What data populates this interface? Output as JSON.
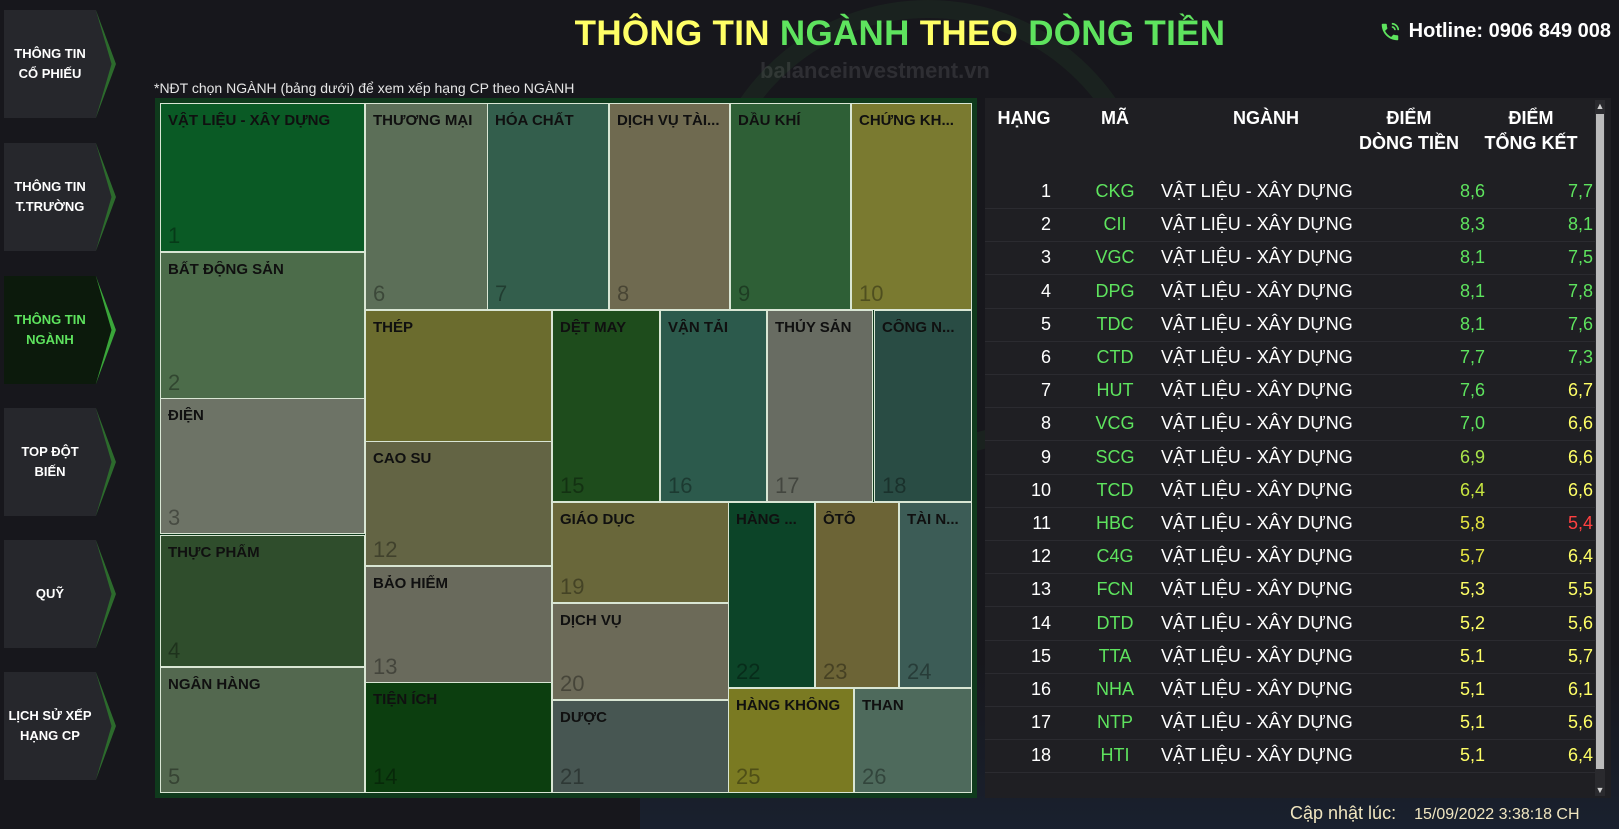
{
  "colors": {
    "yellow": "#ffff66",
    "green": "#5ee35e",
    "red": "#ff4040",
    "panel": "#1f1f23"
  },
  "sidebar": {
    "items": [
      {
        "label": "THÔNG TIN\nCỔ PHIẾU",
        "active": false
      },
      {
        "label": "THÔNG TIN\nT.TRƯỜNG",
        "active": false
      },
      {
        "label": "THÔNG TIN\nNGÀNH",
        "active": true
      },
      {
        "label": "TOP ĐỘT\nBIẾN",
        "active": false
      },
      {
        "label": "QUỸ",
        "active": false
      },
      {
        "label": "LỊCH SỬ XẾP\nHẠNG CP",
        "active": false
      }
    ]
  },
  "header": {
    "title_part1": "THÔNG TIN ",
    "title_part2": "NGÀNH",
    "title_part3": " THEO ",
    "title_part4": "DÒNG TIỀN",
    "hotline": "Hotline: 0906 849 008",
    "watermark": "balanceinvestment.vn",
    "hint": "*NĐT chọn NGÀNH (bảng dưới) để xem xếp hạng CP theo NGÀNH"
  },
  "treemap": {
    "tiles": [
      {
        "label": "VẬT LIỆU - XÂY DỰNG",
        "rank": "1",
        "color": "#0a5a25"
      },
      {
        "label": "BẤT ĐỘNG SẢN",
        "rank": "2",
        "color": "#4c6c4a"
      },
      {
        "label": "ĐIỆN",
        "rank": "3",
        "color": "#6d7366"
      },
      {
        "label": "THỰC PHẨM",
        "rank": "4",
        "color": "#2f4d2c"
      },
      {
        "label": "NGÂN HÀNG",
        "rank": "5",
        "color": "#53684f"
      },
      {
        "label": "THƯƠNG MẠI",
        "rank": "6",
        "color": "#5c6f58"
      },
      {
        "label": "HÓA CHẤT",
        "rank": "7",
        "color": "#335e4c"
      },
      {
        "label": "DỊCH VỤ TÀI...",
        "rank": "8",
        "color": "#6f6a50"
      },
      {
        "label": "DẦU KHÍ",
        "rank": "9",
        "color": "#2e5f36"
      },
      {
        "label": "CHỨNG KH...",
        "rank": "10",
        "color": "#7a7a30"
      },
      {
        "label": "THÉP",
        "rank": "11",
        "color": "#6b6c2e"
      },
      {
        "label": "CAO SU",
        "rank": "12",
        "color": "#636444"
      },
      {
        "label": "BẢO HIỂM",
        "rank": "13",
        "color": "#696a5c"
      },
      {
        "label": "TIỆN ÍCH",
        "rank": "14",
        "color": "#0c3e0f"
      },
      {
        "label": "DỆT MAY",
        "rank": "15",
        "color": "#1e4c1c"
      },
      {
        "label": "VẬN TẢI",
        "rank": "16",
        "color": "#2c5a4c"
      },
      {
        "label": "THỦY SẢN",
        "rank": "17",
        "color": "#686c62"
      },
      {
        "label": "CÔNG N...",
        "rank": "18",
        "color": "#294c44"
      },
      {
        "label": "GIÁO DỤC",
        "rank": "19",
        "color": "#69673a"
      },
      {
        "label": "DỊCH VỤ",
        "rank": "20",
        "color": "#6c6a58"
      },
      {
        "label": "DƯỢC",
        "rank": "21",
        "color": "#475652"
      },
      {
        "label": "HÀNG ...",
        "rank": "22",
        "color": "#0c4428"
      },
      {
        "label": "ÔTÔ",
        "rank": "23",
        "color": "#6c6436"
      },
      {
        "label": "TÀI N...",
        "rank": "24",
        "color": "#3c5c56"
      },
      {
        "label": "HÀNG KHÔNG",
        "rank": "25",
        "color": "#7a7a22"
      },
      {
        "label": "THAN",
        "rank": "26",
        "color": "#4e6a5c"
      }
    ]
  },
  "table": {
    "headers": {
      "rank": "HẠNG",
      "code": "MÃ",
      "sector": "NGÀNH",
      "flow_line1": "ĐIỂM",
      "flow_line2": "DÒNG TIỀN",
      "total_line1": "ĐIỂM",
      "total_line2": "TỔNG KẾT"
    },
    "rows": [
      {
        "rank": "1",
        "code": "CKG",
        "sector": "VẬT LIỆU - XÂY DỰNG",
        "flow": "8,6",
        "total": "7,7",
        "flow_color": "#5ee35e",
        "total_color": "#5ee35e"
      },
      {
        "rank": "2",
        "code": "CII",
        "sector": "VẬT LIỆU - XÂY DỰNG",
        "flow": "8,3",
        "total": "8,1",
        "flow_color": "#5ee35e",
        "total_color": "#5ee35e"
      },
      {
        "rank": "3",
        "code": "VGC",
        "sector": "VẬT LIỆU - XÂY DỰNG",
        "flow": "8,1",
        "total": "7,5",
        "flow_color": "#5ee35e",
        "total_color": "#5ee35e"
      },
      {
        "rank": "4",
        "code": "DPG",
        "sector": "VẬT LIỆU - XÂY DỰNG",
        "flow": "8,1",
        "total": "7,8",
        "flow_color": "#5ee35e",
        "total_color": "#5ee35e"
      },
      {
        "rank": "5",
        "code": "TDC",
        "sector": "VẬT LIỆU - XÂY DỰNG",
        "flow": "8,1",
        "total": "7,6",
        "flow_color": "#5ee35e",
        "total_color": "#5ee35e"
      },
      {
        "rank": "6",
        "code": "CTD",
        "sector": "VẬT LIỆU - XÂY DỰNG",
        "flow": "7,7",
        "total": "7,3",
        "flow_color": "#5ee35e",
        "total_color": "#5ee35e"
      },
      {
        "rank": "7",
        "code": "HUT",
        "sector": "VẬT LIỆU - XÂY DỰNG",
        "flow": "7,6",
        "total": "6,7",
        "flow_color": "#5ee35e",
        "total_color": "#ffff66"
      },
      {
        "rank": "8",
        "code": "VCG",
        "sector": "VẬT LIỆU - XÂY DỰNG",
        "flow": "7,0",
        "total": "6,6",
        "flow_color": "#5ee35e",
        "total_color": "#ffff66"
      },
      {
        "rank": "9",
        "code": "SCG",
        "sector": "VẬT LIỆU - XÂY DỰNG",
        "flow": "6,9",
        "total": "6,6",
        "flow_color": "#a8e34a",
        "total_color": "#ffff66"
      },
      {
        "rank": "10",
        "code": "TCD",
        "sector": "VẬT LIỆU - XÂY DỰNG",
        "flow": "6,4",
        "total": "6,6",
        "flow_color": "#c8e640",
        "total_color": "#ffff66"
      },
      {
        "rank": "11",
        "code": "HBC",
        "sector": "VẬT LIỆU - XÂY DỰNG",
        "flow": "5,8",
        "total": "5,4",
        "flow_color": "#e6e640",
        "total_color": "#ff4040"
      },
      {
        "rank": "12",
        "code": "C4G",
        "sector": "VẬT LIỆU - XÂY DỰNG",
        "flow": "5,7",
        "total": "6,4",
        "flow_color": "#e6e640",
        "total_color": "#ffff66"
      },
      {
        "rank": "13",
        "code": "FCN",
        "sector": "VẬT LIỆU - XÂY DỰNG",
        "flow": "5,3",
        "total": "5,5",
        "flow_color": "#ffff66",
        "total_color": "#ffff66"
      },
      {
        "rank": "14",
        "code": "DTD",
        "sector": "VẬT LIỆU - XÂY DỰNG",
        "flow": "5,2",
        "total": "5,6",
        "flow_color": "#ffff66",
        "total_color": "#ffff66"
      },
      {
        "rank": "15",
        "code": "TTA",
        "sector": "VẬT LIỆU - XÂY DỰNG",
        "flow": "5,1",
        "total": "5,7",
        "flow_color": "#ffff66",
        "total_color": "#ffff66"
      },
      {
        "rank": "16",
        "code": "NHA",
        "sector": "VẬT LIỆU - XÂY DỰNG",
        "flow": "5,1",
        "total": "6,1",
        "flow_color": "#ffff66",
        "total_color": "#ffff66"
      },
      {
        "rank": "17",
        "code": "NTP",
        "sector": "VẬT LIỆU - XÂY DỰNG",
        "flow": "5,1",
        "total": "5,6",
        "flow_color": "#ffff66",
        "total_color": "#ffff66"
      },
      {
        "rank": "18",
        "code": "HTI",
        "sector": "VẬT LIỆU - XÂY DỰNG",
        "flow": "5,1",
        "total": "6,4",
        "flow_color": "#ffff66",
        "total_color": "#ffff66"
      }
    ]
  },
  "footer": {
    "updated_label": "Cập nhật lúc:",
    "updated_value": "15/09/2022 3:38:18 CH"
  }
}
